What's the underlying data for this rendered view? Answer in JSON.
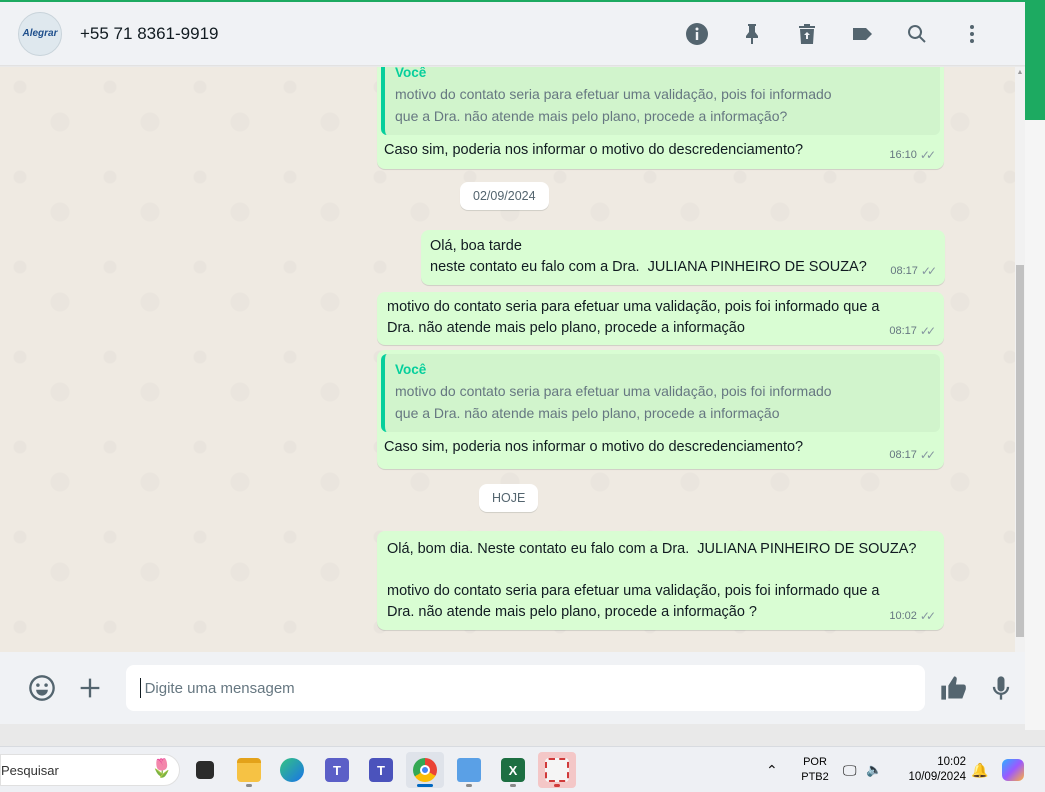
{
  "header": {
    "avatar_text": "Alegrar",
    "contact": "+55 71 8361-9919",
    "icons": [
      "info-icon",
      "pin-icon",
      "trash-icon",
      "label-icon",
      "search-icon",
      "menu-icon"
    ]
  },
  "messages": [
    {
      "quote_author": "Você",
      "quote_line1": "motivo do contato seria para efetuar uma validação, pois foi informado",
      "quote_line2": "que a Dra. não atende mais pelo plano, procede a informação?",
      "text": "Caso sim, poderia nos informar o motivo do descredenciamento?",
      "time": "16:10"
    },
    {
      "date": "02/09/2024"
    },
    {
      "text": "Olá, boa tarde\nneste contato eu falo com a Dra.  JULIANA PINHEIRO DE SOUZA?",
      "time": "08:17"
    },
    {
      "text": "motivo do contato seria para efetuar uma validação, pois foi informado que a\nDra. não atende mais pelo plano, procede a informação",
      "time": "08:17"
    },
    {
      "quote_author": "Você",
      "quote_line1": "motivo do contato seria para efetuar uma validação, pois foi informado",
      "quote_line2": "que a Dra. não atende mais pelo plano, procede a informação",
      "text": "Caso sim, poderia nos informar o motivo do descredenciamento?",
      "time": "08:17"
    },
    {
      "date": "HOJE"
    },
    {
      "text": "Olá, bom dia. Neste contato eu falo com a Dra.  JULIANA PINHEIRO DE SOUZA?\n\nmotivo do contato seria para efetuar uma validação, pois foi informado que a\nDra. não atende mais pelo plano, procede a informação ?",
      "time": "10:02"
    }
  ],
  "composer": {
    "placeholder": "Digite uma mensagem",
    "icons": [
      "emoji-icon",
      "plus-icon",
      "thumbs-up-icon",
      "microphone-icon"
    ]
  },
  "taskbar": {
    "search_placeholder": "Pesquisar",
    "apps": [
      "task-view",
      "file-explorer",
      "edge",
      "teams-classic",
      "teams",
      "chrome",
      "notepad",
      "excel",
      "snipping-tool"
    ],
    "lang_top": "POR",
    "lang_bottom": "PTB2",
    "time": "10:02",
    "date": "10/09/2024"
  },
  "colors": {
    "bubble_out": "#d9fdd3",
    "accent": "#1daa61",
    "quote_bar": "#06cf9c",
    "chat_bg": "#efeae2"
  }
}
